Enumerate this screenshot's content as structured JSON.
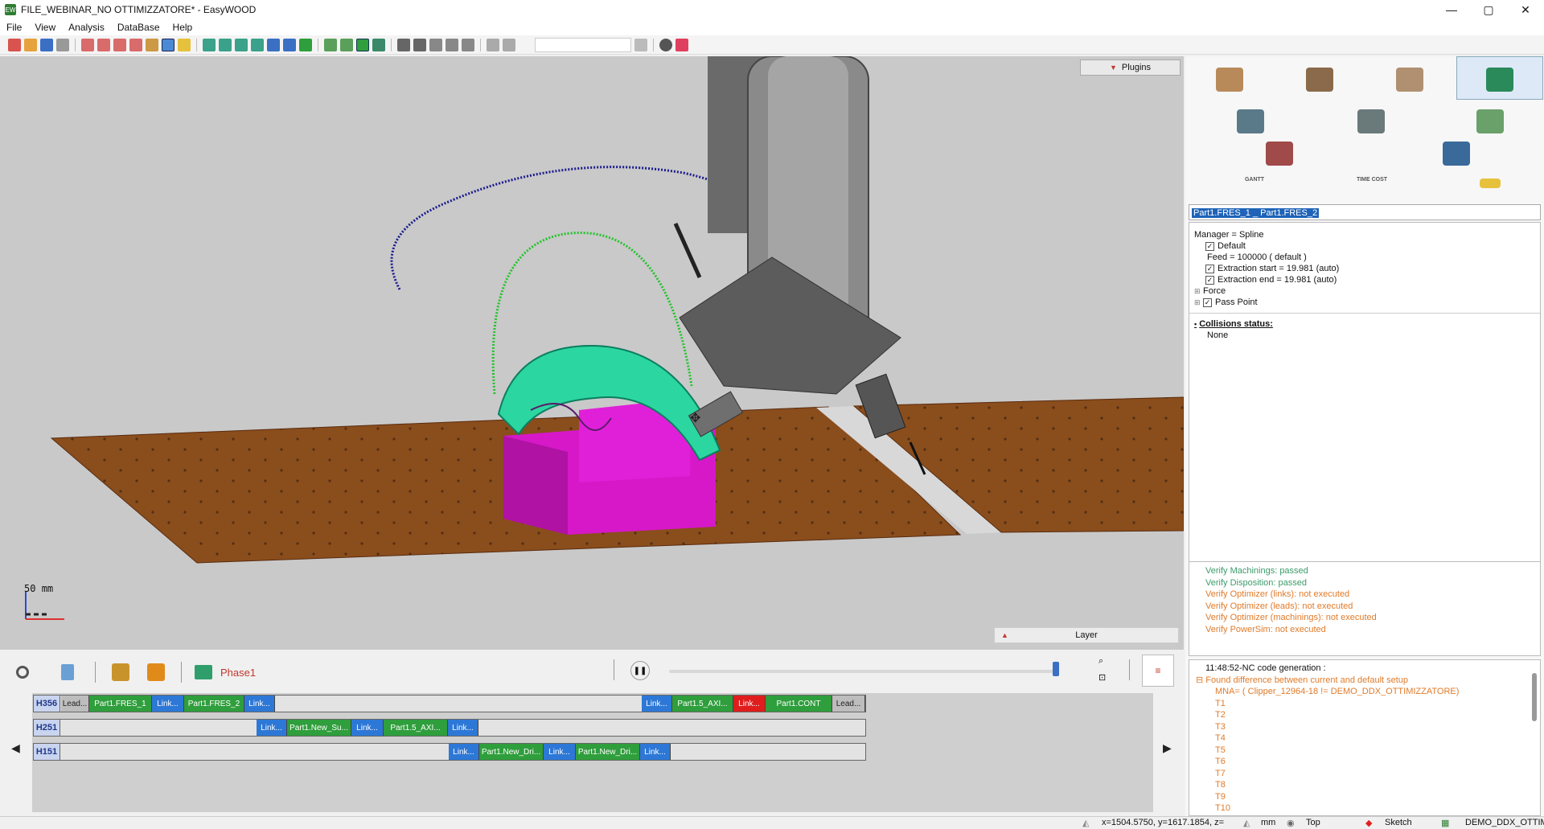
{
  "window": {
    "title": "FILE_WEBINAR_NO OTTIMIZZATORE* - EasyWOOD",
    "app_icon_text": "EW",
    "min": "—",
    "max": "▢",
    "close": "✕"
  },
  "menu": [
    "File",
    "View",
    "Analysis",
    "DataBase",
    "Help"
  ],
  "viewport": {
    "plugins_label": "Plugins",
    "layer_label": "Layer",
    "scale_value": "50",
    "scale_unit": "mm"
  },
  "right_panel": {
    "plugin_labels": {
      "gantt": "GANTT",
      "time_cost": "TIME COST"
    },
    "selected_name": "Part1.FRES_1 _ Part1.FRES_2",
    "props": {
      "manager": "Manager = Spline",
      "default": "Default",
      "feed": "Feed = 100000 ( default )",
      "extraction_start": "Extraction start = 19.981 (auto)",
      "extraction_end": "Extraction end = 19.981 (auto)",
      "force": "Force",
      "pass_point": "Pass Point",
      "collisions_title": "Collisions status:",
      "collisions_value": "None"
    },
    "verify": [
      {
        "text": "Verify Machinings: passed",
        "status": "ok"
      },
      {
        "text": "Verify Disposition: passed",
        "status": "ok"
      },
      {
        "text": "Verify Optimizer (links): not executed",
        "status": "warn"
      },
      {
        "text": "Verify Optimizer (leads): not executed",
        "status": "warn"
      },
      {
        "text": "Verify Optimizer (machinings): not executed",
        "status": "warn"
      },
      {
        "text": "Verify PowerSim: not executed",
        "status": "warn"
      }
    ],
    "log": {
      "header": "11:48:52-NC code generation :",
      "diff": "Found difference between current and default setup",
      "mna": "MNA= ( Clipper_12964-18 != DEMO_DDX_OTTIMIZZATORE)",
      "tools": [
        "T1",
        "T2",
        "T3",
        "T4",
        "T5",
        "T6",
        "T7",
        "T8",
        "T9",
        "T10"
      ]
    }
  },
  "sim_bar": {
    "phase": "Phase1"
  },
  "timeline": {
    "rows": [
      {
        "head": "H356",
        "segments": [
          {
            "label": "Lead...",
            "kind": "lead"
          },
          {
            "label": "Part1.FRES_1",
            "kind": "green"
          },
          {
            "label": "Link...",
            "kind": "blue"
          },
          {
            "label": "Part1.FRES_2",
            "kind": "green"
          },
          {
            "label": "Link...",
            "kind": "blue"
          },
          {
            "label": "Link...",
            "kind": "blue"
          },
          {
            "label": "Part1.5_AXI...",
            "kind": "green"
          },
          {
            "label": "Link...",
            "kind": "red"
          },
          {
            "label": "Part1.CONT",
            "kind": "green"
          },
          {
            "label": "Lead...",
            "kind": "lead"
          }
        ]
      },
      {
        "head": "H251",
        "segments": [
          {
            "label": "Link...",
            "kind": "blue"
          },
          {
            "label": "Part1.New_Su...",
            "kind": "green"
          },
          {
            "label": "Link...",
            "kind": "blue"
          },
          {
            "label": "Part1.5_AXI...",
            "kind": "green"
          },
          {
            "label": "Link...",
            "kind": "blue"
          }
        ]
      },
      {
        "head": "H151",
        "segments": [
          {
            "label": "Link...",
            "kind": "blue"
          },
          {
            "label": "Part1.New_Dri...",
            "kind": "green"
          },
          {
            "label": "Link...",
            "kind": "blue"
          },
          {
            "label": "Part1.New_Dri...",
            "kind": "green"
          },
          {
            "label": "Link...",
            "kind": "blue"
          }
        ]
      }
    ]
  },
  "status": {
    "coords": "x=1504.5750, y=1617.1854, z=",
    "unit": "mm",
    "view": "Top",
    "mode": "Sketch",
    "machine": "DEMO_DDX_OTTIM"
  },
  "colors": {
    "accent": "#1e63b8",
    "ok": "#3c9a6a",
    "warn": "#e07b2a",
    "part": "#e020d8",
    "table": "#8a4d1c",
    "spline_blue": "#1b1b8f",
    "spline_green": "#22c32a"
  }
}
